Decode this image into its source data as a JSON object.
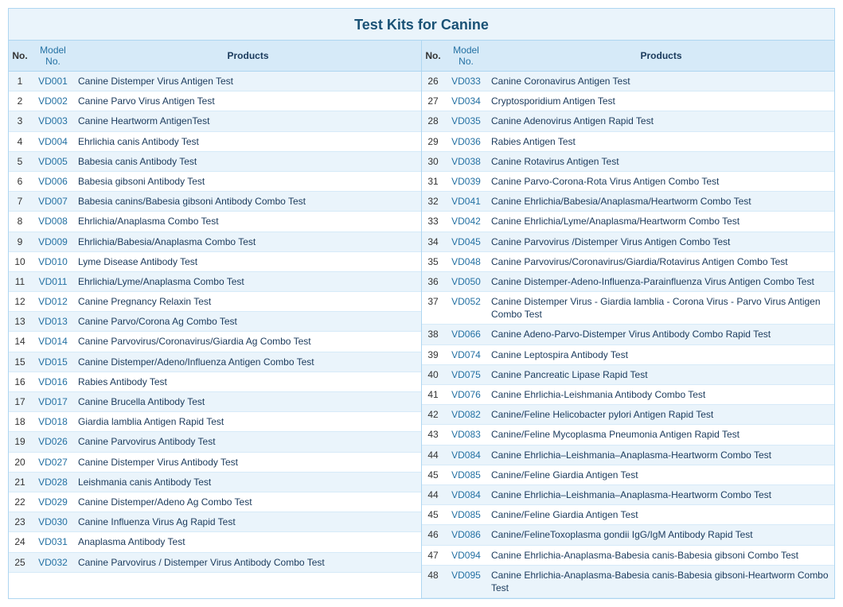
{
  "title": "Test Kits for Canine",
  "headers": {
    "no": "No.",
    "model": "Model No.",
    "products": "Products"
  },
  "left_rows": [
    {
      "no": 1,
      "model": "VD001",
      "product": "Canine Distemper Virus Antigen Test"
    },
    {
      "no": 2,
      "model": "VD002",
      "product": "Canine Parvo Virus Antigen Test"
    },
    {
      "no": 3,
      "model": "VD003",
      "product": "Canine Heartworm AntigenTest"
    },
    {
      "no": 4,
      "model": "VD004",
      "product": "Ehrlichia canis Antibody Test"
    },
    {
      "no": 5,
      "model": "VD005",
      "product": "Babesia canis Antibody Test"
    },
    {
      "no": 6,
      "model": "VD006",
      "product": "Babesia gibsoni Antibody Test"
    },
    {
      "no": 7,
      "model": "VD007",
      "product": "Babesia canins/Babesia gibsoni Antibody Combo Test"
    },
    {
      "no": 8,
      "model": "VD008",
      "product": "Ehrlichia/Anaplasma Combo Test"
    },
    {
      "no": 9,
      "model": "VD009",
      "product": "Ehrlichia/Babesia/Anaplasma Combo Test"
    },
    {
      "no": 10,
      "model": "VD010",
      "product": "Lyme Disease Antibody Test"
    },
    {
      "no": 11,
      "model": "VD011",
      "product": "Ehrlichia/Lyme/Anaplasma Combo Test"
    },
    {
      "no": 12,
      "model": "VD012",
      "product": "Canine Pregnancy Relaxin Test"
    },
    {
      "no": 13,
      "model": "VD013",
      "product": "Canine Parvo/Corona Ag Combo Test"
    },
    {
      "no": 14,
      "model": "VD014",
      "product": "Canine Parvovirus/Coronavirus/Giardia Ag Combo Test"
    },
    {
      "no": 15,
      "model": "VD015",
      "product": "Canine Distemper/Adeno/Influenza Antigen Combo Test"
    },
    {
      "no": 16,
      "model": "VD016",
      "product": "Rabies Antibody Test"
    },
    {
      "no": 17,
      "model": "VD017",
      "product": "Canine Brucella Antibody Test"
    },
    {
      "no": 18,
      "model": "VD018",
      "product": "Giardia lamblia Antigen Rapid Test"
    },
    {
      "no": 19,
      "model": "VD026",
      "product": "Canine Parvovirus Antibody Test"
    },
    {
      "no": 20,
      "model": "VD027",
      "product": "Canine Distemper Virus Antibody Test"
    },
    {
      "no": 21,
      "model": "VD028",
      "product": "Leishmania canis Antibody Test"
    },
    {
      "no": 22,
      "model": "VD029",
      "product": "Canine Distemper/Adeno Ag Combo Test"
    },
    {
      "no": 23,
      "model": "VD030",
      "product": "Canine Influenza Virus Ag Rapid Test"
    },
    {
      "no": 24,
      "model": "VD031",
      "product": "Anaplasma Antibody Test"
    },
    {
      "no": 25,
      "model": "VD032",
      "product": "Canine Parvovirus / Distemper Virus Antibody Combo Test"
    }
  ],
  "right_rows": [
    {
      "no": 26,
      "model": "VD033",
      "product": "Canine Coronavirus Antigen Test"
    },
    {
      "no": 27,
      "model": "VD034",
      "product": "Cryptosporidium Antigen Test"
    },
    {
      "no": 28,
      "model": "VD035",
      "product": "Canine Adenovirus Antigen Rapid Test"
    },
    {
      "no": 29,
      "model": "VD036",
      "product": "Rabies Antigen Test"
    },
    {
      "no": 30,
      "model": "VD038",
      "product": "Canine Rotavirus Antigen Test"
    },
    {
      "no": 31,
      "model": "VD039",
      "product": "Canine Parvo-Corona-Rota Virus Antigen Combo Test"
    },
    {
      "no": 32,
      "model": "VD041",
      "product": "Canine Ehrlichia/Babesia/Anaplasma/Heartworm Combo Test"
    },
    {
      "no": 33,
      "model": "VD042",
      "product": "Canine Ehrlichia/Lyme/Anaplasma/Heartworm Combo Test"
    },
    {
      "no": 34,
      "model": "VD045",
      "product": "Canine Parvovirus /Distemper Virus Antigen Combo Test"
    },
    {
      "no": 35,
      "model": "VD048",
      "product": "Canine Parvovirus/Coronavirus/Giardia/Rotavirus Antigen Combo Test"
    },
    {
      "no": 36,
      "model": "VD050",
      "product": "Canine Distemper-Adeno-Influenza-Parainfluenza Virus Antigen Combo Test"
    },
    {
      "no": 37,
      "model": "VD052",
      "product": "Canine Distemper Virus - Giardia lamblia - Corona Virus - Parvo Virus Antigen Combo Test"
    },
    {
      "no": 38,
      "model": "VD066",
      "product": "Canine Adeno-Parvo-Distemper Virus Antibody Combo Rapid Test"
    },
    {
      "no": 39,
      "model": "VD074",
      "product": "Canine Leptospira Antibody Test"
    },
    {
      "no": 40,
      "model": "VD075",
      "product": "Canine Pancreatic Lipase Rapid Test"
    },
    {
      "no": 41,
      "model": "VD076",
      "product": "Canine Ehrlichia-Leishmania Antibody Combo Test"
    },
    {
      "no": 42,
      "model": "VD082",
      "product": "Canine/Feline Helicobacter pylori Antigen Rapid Test"
    },
    {
      "no": 43,
      "model": "VD083",
      "product": "Canine/Feline  Mycoplasma Pneumonia Antigen Rapid Test"
    },
    {
      "no": 44,
      "model": "VD084",
      "product": "Canine Ehrlichia–Leishmania–Anaplasma-Heartworm Combo Test"
    },
    {
      "no": 45,
      "model": "VD085",
      "product": "Canine/Feline  Giardia Antigen Test"
    },
    {
      "no": 44,
      "model": "VD084",
      "product": "Canine Ehrlichia–Leishmania–Anaplasma-Heartworm Combo Test"
    },
    {
      "no": 45,
      "model": "VD085",
      "product": "Canine/Feline  Giardia Antigen Test"
    },
    {
      "no": 46,
      "model": "VD086",
      "product": "Canine/FelineToxoplasma gondii IgG/IgM Antibody Rapid Test"
    },
    {
      "no": 47,
      "model": "VD094",
      "product": "Canine Ehrlichia-Anaplasma-Babesia canis-Babesia gibsoni Combo Test"
    },
    {
      "no": 48,
      "model": "VD095",
      "product": "Canine Ehrlichia-Anaplasma-Babesia canis-Babesia gibsoni-Heartworm Combo Test"
    }
  ]
}
